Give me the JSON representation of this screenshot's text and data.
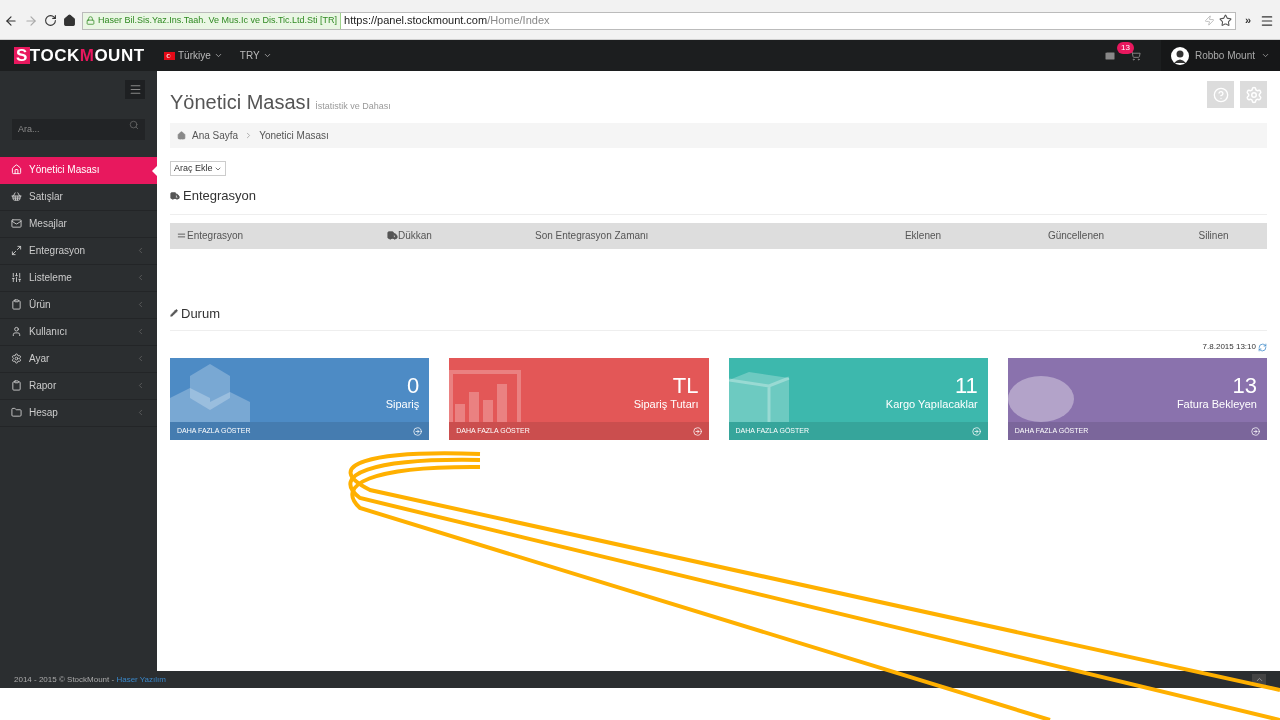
{
  "browser": {
    "cert_label": "Haser Bil.Sis.Yaz.Ins.Taah. Ve Mus.Ic ve Dis.Tic.Ltd.Sti [TR]",
    "url_host": "https://panel.stockmount.com",
    "url_path": "/Home/Index",
    "overflow": "»"
  },
  "navbar": {
    "logo": [
      {
        "text": "S",
        "kind": "boxed"
      },
      {
        "text": "TOCK",
        "kind": "plain"
      },
      {
        "text": "M",
        "kind": "accent"
      },
      {
        "text": "OUNT",
        "kind": "plain"
      }
    ],
    "menus": [
      {
        "label": "Türkiye",
        "flag": true
      },
      {
        "label": "TRY",
        "flag": false
      }
    ],
    "cart_badge": "13",
    "user": "Robbo Mount"
  },
  "sidebar": {
    "search": {
      "placeholder": "Ara..."
    },
    "items": [
      {
        "kind": "home",
        "label": "Yönetici Masası",
        "selected": true,
        "expandable": false
      },
      {
        "kind": "cart",
        "label": "Satışlar",
        "selected": false,
        "expandable": false
      },
      {
        "kind": "mail",
        "label": "Mesajlar",
        "selected": false,
        "expandable": false
      },
      {
        "kind": "arrows",
        "label": "Entegrasyon",
        "selected": false,
        "expandable": true
      },
      {
        "kind": "sliders",
        "label": "Listeleme",
        "selected": false,
        "expandable": true
      },
      {
        "kind": "clipboard",
        "label": "Ürün",
        "selected": false,
        "expandable": true
      },
      {
        "kind": "user",
        "label": "Kullanıcı",
        "selected": false,
        "expandable": true
      },
      {
        "kind": "gear",
        "label": "Ayar",
        "selected": false,
        "expandable": true
      },
      {
        "kind": "clipboard",
        "label": "Rapor",
        "selected": false,
        "expandable": true
      },
      {
        "kind": "folder",
        "label": "Hesap",
        "selected": false,
        "expandable": true
      }
    ]
  },
  "page": {
    "title": "Yönetici Masası",
    "subtitle": "İstatistik ve Dahası",
    "breadcrumb": [
      "Ana Sayfa",
      "Yonetici Masası"
    ],
    "add_tool_button": "Araç Ekle",
    "integration": {
      "title": "Entegrasyon",
      "columns": [
        {
          "label": "Entegrasyon",
          "kind": "lines"
        },
        {
          "label": "Dükkan",
          "kind": "truck"
        },
        {
          "label": "Son Entegrasyon Zamanı",
          "kind": "plain"
        },
        {
          "label": "Eklenen",
          "kind": "plain"
        },
        {
          "label": "Güncellenen",
          "kind": "plain"
        },
        {
          "label": "Silinen",
          "kind": "plain"
        }
      ]
    },
    "status": {
      "title": "Durum",
      "timestamp": "7.8.2015 13:10",
      "tiles": [
        {
          "value": "0",
          "label": "Sipariş",
          "more": "DAHA FAZLA GÖSTER",
          "color": "#4d8bc5",
          "kind": "cubes"
        },
        {
          "value": "TL",
          "label": "Sipariş Tutarı",
          "more": "DAHA FAZLA GÖSTER",
          "color": "#e35757",
          "kind": "chart"
        },
        {
          "value": "11",
          "label": "Kargo Yapılacaklar",
          "more": "DAHA FAZLA GÖSTER",
          "color": "#3db8ad",
          "kind": "box"
        },
        {
          "value": "13",
          "label": "Fatura Bekleyen",
          "more": "DAHA FAZLA GÖSTER",
          "color": "#8a72ad",
          "kind": "circle"
        }
      ]
    }
  },
  "footer": {
    "text": "2014 - 2015 © StockMount - ",
    "link": "Haser Yazılım"
  }
}
